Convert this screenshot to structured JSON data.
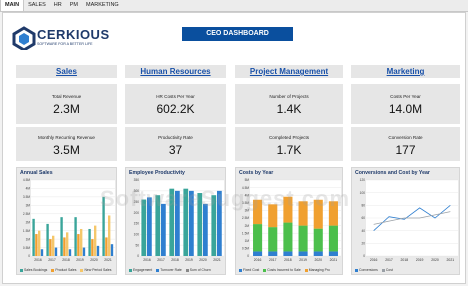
{
  "tabs": [
    "MAIN",
    "SALES",
    "HR",
    "PM",
    "MARKETING"
  ],
  "brand": {
    "name": "CERKIOUS",
    "tagline": "SOFTWARE FOR A BETTER LIFE"
  },
  "dashboard_title": "CEO DASHBOARD",
  "sections": [
    "Sales",
    "Human Resources",
    "Project Management",
    "Marketing"
  ],
  "kpis": [
    {
      "label": "Total Revenue",
      "value": "2.3M"
    },
    {
      "label": "HR Costs Per Year",
      "value": "602.2K"
    },
    {
      "label": "Number of Projects",
      "value": "1.4K"
    },
    {
      "label": "Costs Per Year",
      "value": "14.0M"
    },
    {
      "label": "Monthly Recurring Revenue",
      "value": "3.5M"
    },
    {
      "label": "Productivity Rate",
      "value": "37"
    },
    {
      "label": "Completed Projects",
      "value": "1.7K"
    },
    {
      "label": "Conversion Rate",
      "value": "177"
    }
  ],
  "colors": {
    "accent": "#0a4f9e",
    "teal": "#3aa59a",
    "orange": "#f0a030",
    "blue": "#2f7fd0",
    "green": "#4cbf4c",
    "gray": "#9aa0a6"
  },
  "watermark": "SoftwareSuggest.com",
  "chart_data": [
    {
      "type": "bar",
      "title": "Annual Sales",
      "categories": [
        "2016",
        "2017",
        "2018",
        "2019",
        "2020",
        "2021"
      ],
      "ylim": [
        0,
        4.5
      ],
      "yticks": [
        "0",
        "0.5M",
        "1M",
        "1.5M",
        "2M",
        "2.5M",
        "3M",
        "3.5M",
        "4M",
        "4.5M"
      ],
      "series": [
        {
          "name": "Sales Bookings",
          "color": "#3aa59a",
          "values": [
            2.2,
            1.9,
            2.3,
            2.3,
            1.6,
            3.5
          ]
        },
        {
          "name": "Product Sales",
          "color": "#f0a030",
          "values": [
            1.3,
            1.0,
            1.1,
            1.3,
            1.0,
            1.1
          ]
        },
        {
          "name": "New Period Sales",
          "color": "#f5c76a",
          "values": [
            1.5,
            1.2,
            1.4,
            1.6,
            1.8,
            2.4
          ]
        },
        {
          "name": "Sales",
          "color": "#2f7fd0",
          "values": [
            0.4,
            0.5,
            0.4,
            0.5,
            0.6,
            0.7
          ]
        }
      ],
      "legend": [
        "Sales Bookings",
        "Product Sales",
        "New Period Sales",
        "Sales"
      ]
    },
    {
      "type": "bar",
      "title": "Employee Productivity",
      "categories": [
        "2016",
        "2017",
        "2018",
        "2019",
        "2020",
        "2021"
      ],
      "ylim": [
        0,
        350
      ],
      "yticks": [
        "0",
        "50",
        "100",
        "150",
        "200",
        "250",
        "300",
        "350"
      ],
      "series": [
        {
          "name": "Engagement",
          "color": "#3aa59a",
          "values": [
            260,
            280,
            310,
            310,
            290,
            280
          ]
        },
        {
          "name": "Turnover Rate",
          "color": "#2f7fd0",
          "values": [
            270,
            240,
            300,
            300,
            240,
            300
          ]
        }
      ],
      "legend": [
        "Engagement",
        "Turnover Rate",
        "Sum of Churn"
      ]
    },
    {
      "type": "bar",
      "title": "Costs by Year",
      "categories": [
        "2016",
        "2017",
        "2018",
        "2019",
        "2020",
        "2021"
      ],
      "ylim": [
        0,
        5
      ],
      "yticks": [
        "0",
        "0.5M",
        "1M",
        "1.5M",
        "2M",
        "2.5M",
        "3M",
        "3.5M",
        "4M",
        "4.5M",
        "5M"
      ],
      "series": [
        {
          "name": "Fixed Cost",
          "color": "#2f7fd0",
          "values": [
            0.3,
            0.3,
            0.3,
            0.3,
            0.3,
            0.3
          ]
        },
        {
          "name": "Costs Incurred to Sale",
          "color": "#4cbf4c",
          "values": [
            1.8,
            1.6,
            1.9,
            1.7,
            1.5,
            1.7
          ]
        },
        {
          "name": "Managing Pro",
          "color": "#f0a030",
          "values": [
            1.6,
            1.5,
            1.7,
            1.6,
            1.9,
            1.6
          ]
        }
      ],
      "legend": [
        "Fixed Cost",
        "Costs Incurred to Sale",
        "Managing Pro"
      ]
    },
    {
      "type": "line",
      "title": "Conversions and Cost by Year",
      "categories": [
        "2016",
        "2017",
        "2018",
        "2019",
        "2020",
        "2021"
      ],
      "ylim": [
        0,
        120
      ],
      "yticks": [
        "0",
        "20",
        "40",
        "60",
        "80",
        "100",
        "120"
      ],
      "series": [
        {
          "name": "Conversions",
          "color": "#2f7fd0",
          "values": [
            40,
            62,
            58,
            76,
            60,
            80
          ]
        },
        {
          "name": "Cost",
          "color": "#9aa0a6",
          "values": [
            50,
            55,
            60,
            60,
            65,
            70
          ]
        }
      ],
      "legend": [
        "Conversions",
        "Cost"
      ]
    }
  ]
}
